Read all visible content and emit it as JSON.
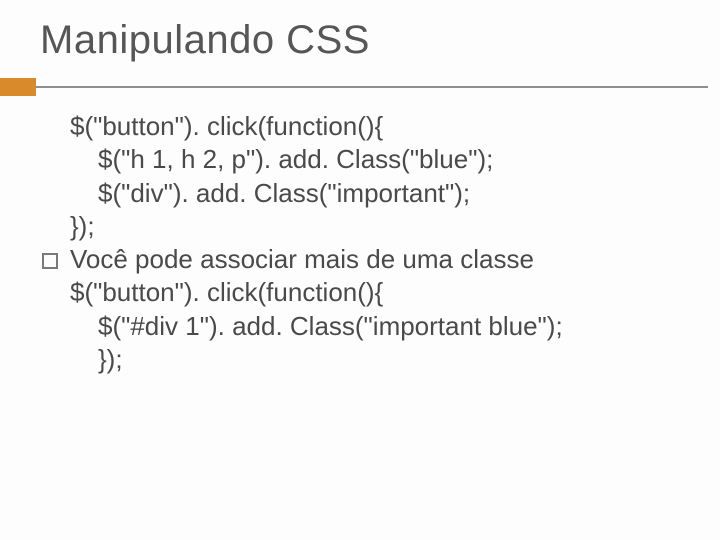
{
  "title": "Manipulando CSS",
  "code1": {
    "l1": "$(\"button\"). click(function(){",
    "l2": "$(\"h 1, h 2, p\"). add. Class(\"blue\");",
    "l3": "$(\"div\"). add. Class(\"important\");",
    "l4": "});"
  },
  "bullet": "Você pode associar mais de uma classe",
  "code2": {
    "l1": "$(\"button\"). click(function(){",
    "l2": "$(\"#div 1\"). add. Class(\"important blue\");",
    "l3": "});"
  }
}
